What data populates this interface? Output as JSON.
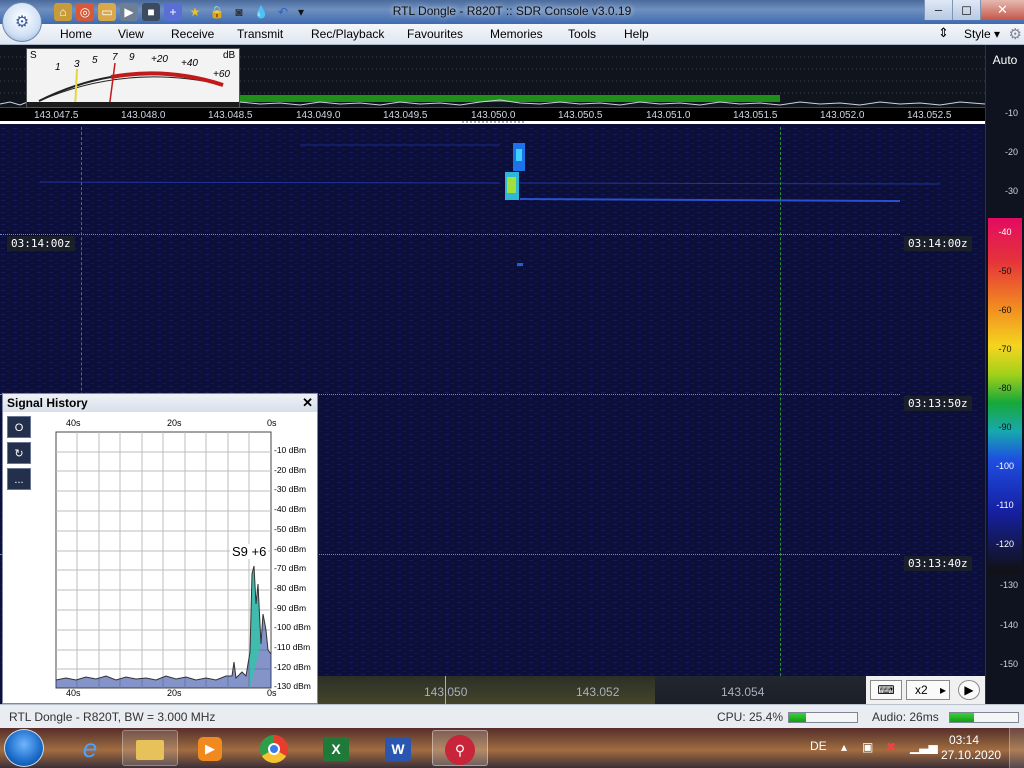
{
  "window": {
    "title": "RTL Dongle - R820T :: SDR Console v3.0.19",
    "minimize_icon": "minimize-icon",
    "maximize_icon": "maximize-icon",
    "close_icon": "close-icon"
  },
  "quick_access": [
    "home-icon",
    "help-ring-icon",
    "folder-icon",
    "play-icon",
    "stop-icon",
    "add-icon",
    "star-icon",
    "lock-icon",
    "camera-icon",
    "drop-icon",
    "undo-icon",
    "dropdown-icon"
  ],
  "menu": {
    "items": [
      "Home",
      "View",
      "Receive",
      "Transmit",
      "Rec/Playback",
      "Favourites",
      "Memories",
      "Tools",
      "Help"
    ],
    "style_label": "Style"
  },
  "meter": {
    "s_label": "S",
    "db_label": "dB",
    "s_scale": [
      "1",
      "3",
      "5",
      "7",
      "9"
    ],
    "db_scale": [
      "+20",
      "+40",
      "+60"
    ]
  },
  "frequency_axis": [
    "143.047.5",
    "143.048.0",
    "143.048.5",
    "143.049.0",
    "143.049.5",
    "143.050.0",
    "143.050.5",
    "143.051.0",
    "143.051.5",
    "143.052.0",
    "143.052.5"
  ],
  "waterfall": {
    "timestamps": [
      {
        "left": "03:14:00z",
        "right": "03:14:00z"
      },
      {
        "left": "",
        "right": "03:13:50z"
      },
      {
        "left": "",
        "right": "03:13:40z"
      }
    ]
  },
  "level_scale": {
    "auto_label": "Auto",
    "ticks": [
      "-10",
      "-20",
      "-30",
      "-40",
      "-50",
      "-60",
      "-70",
      "-80",
      "-90",
      "-100",
      "-110",
      "-120",
      "-130",
      "-140",
      "-150"
    ]
  },
  "signal_history": {
    "title": "Signal History",
    "tools": [
      "O",
      "↻",
      "..."
    ],
    "time_top": [
      "40s",
      "20s",
      "0s"
    ],
    "time_bottom": [
      "40s",
      "20s",
      "0s"
    ],
    "dbm_labels": [
      "-10 dBm",
      "-20 dBm",
      "-30 dBm",
      "-40 dBm",
      "-50 dBm",
      "-60 dBm",
      "-70 dBm",
      "-80 dBm",
      "-90 dBm",
      "-100 dBm",
      "-110 dBm",
      "-120 dBm",
      "-130 dBm"
    ],
    "reading": "S9 +6"
  },
  "bottom_band": {
    "freqs": [
      "143.050",
      "143.052",
      "143.054"
    ],
    "keyboard_icon": "keyboard-icon",
    "zoom_label": "x2",
    "arrow_icon": "play-arrow-icon",
    "record_icon": "forward-circle-icon"
  },
  "status": {
    "left": "RTL Dongle - R820T, BW = 3.000 MHz",
    "cpu_label": "CPU: 25.4%",
    "cpu_level": 0.25,
    "audio_label": "Audio: 26ms",
    "audio_level": 0.35
  },
  "taskbar": {
    "apps": [
      "ie-icon",
      "explorer-icon",
      "media-icon",
      "chrome-icon",
      "excel-icon",
      "word-icon",
      "sdr-console-icon"
    ],
    "language": "DE",
    "time": "03:14",
    "date": "27.10.2020"
  },
  "colors": {
    "waterfall_bg": "#0b0f3a",
    "signal": "#3fd0ff",
    "grid_green": "#2f8f2f"
  }
}
